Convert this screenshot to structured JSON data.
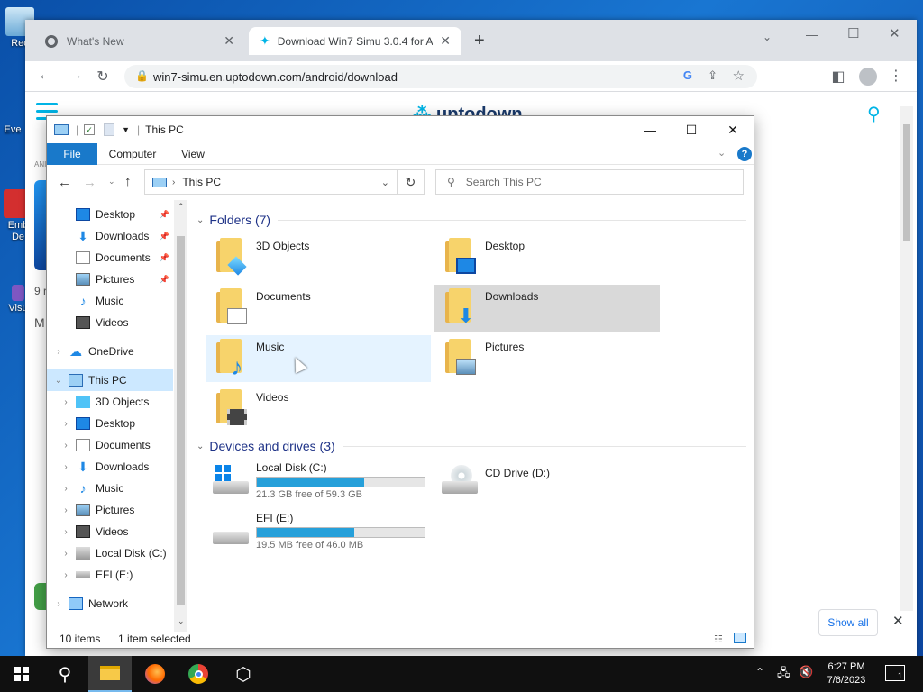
{
  "desktop": {
    "icons": [
      {
        "label": "Rec"
      },
      {
        "label": "Eve"
      },
      {
        "label": "Emb\nDe"
      },
      {
        "label": "Visu"
      }
    ]
  },
  "browser": {
    "tabs": [
      {
        "title": "What's New"
      },
      {
        "title": "Download Win7 Simu 3.0.4 for A"
      }
    ],
    "address": "win7-simu.en.uptodown.com/android/download",
    "page": {
      "brand": "uptodown",
      "side_text_1": "9 r",
      "side_text_2": "M",
      "side_text_3": "ANI",
      "show_all": "Show all"
    }
  },
  "explorer": {
    "title": "This PC",
    "ribbon_tabs": [
      "File",
      "Computer",
      "View"
    ],
    "address": "This PC",
    "search_placeholder": "Search This PC",
    "nav": {
      "quick": [
        {
          "label": "Desktop",
          "pinned": true
        },
        {
          "label": "Downloads",
          "pinned": true
        },
        {
          "label": "Documents",
          "pinned": true
        },
        {
          "label": "Pictures",
          "pinned": true
        },
        {
          "label": "Music",
          "pinned": false
        },
        {
          "label": "Videos",
          "pinned": false
        }
      ],
      "onedrive": "OneDrive",
      "thispc": "This PC",
      "thispc_children": [
        "3D Objects",
        "Desktop",
        "Documents",
        "Downloads",
        "Music",
        "Pictures",
        "Videos",
        "Local Disk (C:)",
        "EFI (E:)"
      ],
      "network": "Network"
    },
    "folders_header": "Folders (7)",
    "folders": [
      {
        "name": "3D Objects"
      },
      {
        "name": "Desktop"
      },
      {
        "name": "Documents"
      },
      {
        "name": "Downloads"
      },
      {
        "name": "Music"
      },
      {
        "name": "Pictures"
      },
      {
        "name": "Videos"
      }
    ],
    "drives_header": "Devices and drives (3)",
    "drives": [
      {
        "name": "Local Disk (C:)",
        "free": "21.3 GB free of 59.3 GB",
        "used_fraction": 0.64
      },
      {
        "name": "CD Drive (D:)"
      },
      {
        "name": "EFI (E:)",
        "free": "19.5 MB free of 46.0 MB",
        "used_fraction": 0.58
      }
    ],
    "status": {
      "items": "10 items",
      "selected": "1 item selected"
    }
  },
  "taskbar": {
    "time": "6:27 PM",
    "date": "7/6/2023",
    "notification_count": "1"
  },
  "colors": {
    "accent": "#1979ca",
    "selection": "#cce8ff",
    "drive_fill": "#26a0da",
    "folder": "#f7d36b"
  }
}
